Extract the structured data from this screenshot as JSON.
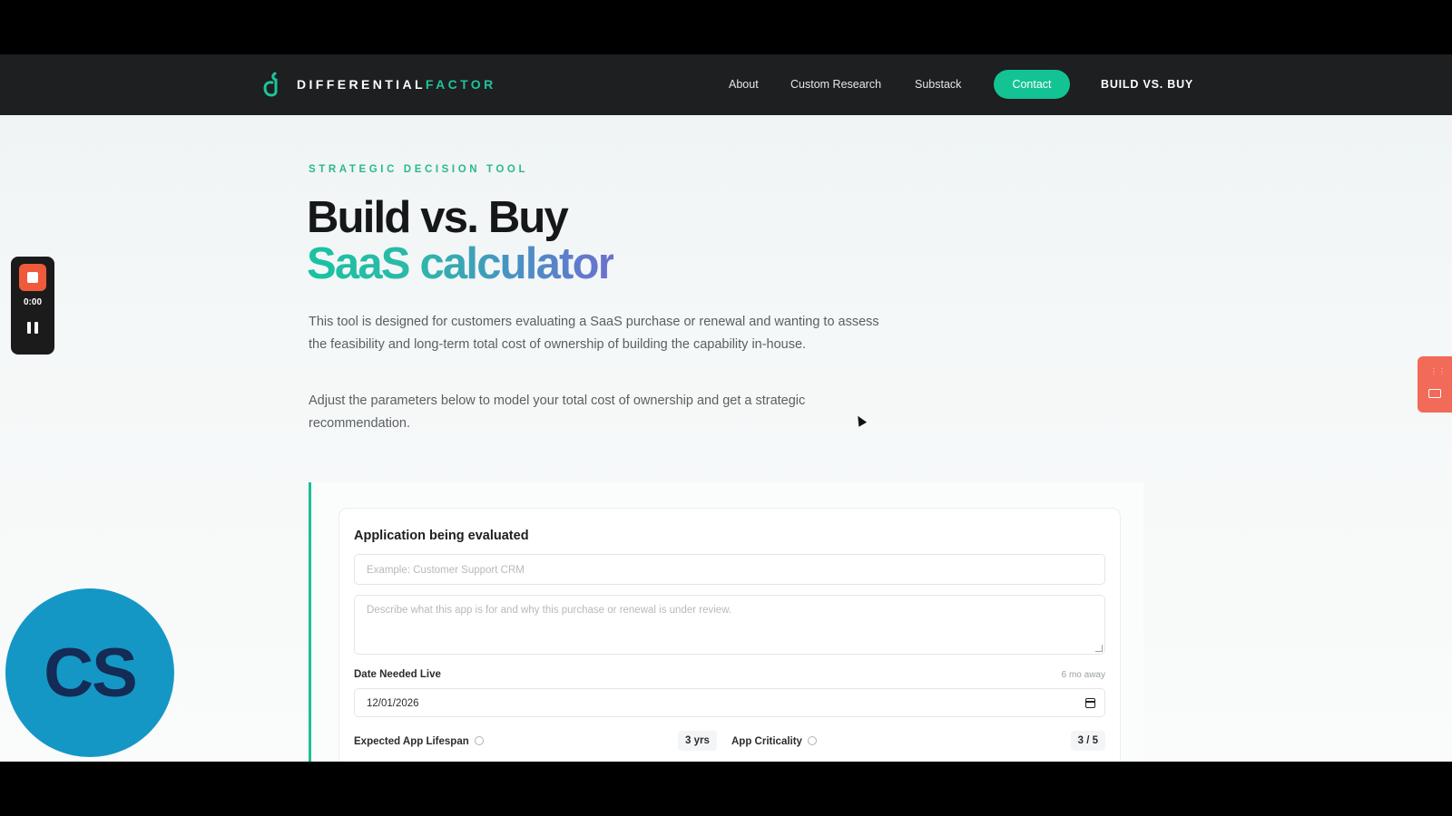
{
  "header": {
    "logo": {
      "word1": "DIFFERENTIAL",
      "word2": "FACTOR",
      "icon": "df-logo-icon",
      "accent": "#1fc39a"
    },
    "nav": {
      "about": "About",
      "custom_research": "Custom Research",
      "substack": "Substack"
    },
    "contact_label": "Contact",
    "build_vs_buy": "BUILD VS. BUY"
  },
  "hero": {
    "eyebrow": "STRATEGIC DECISION TOOL",
    "title_line1": "Build vs. Buy",
    "title_line2": "SaaS calculator",
    "description1": "This tool is designed for customers evaluating a SaaS purchase or renewal and wanting to assess the feasibility and long-term total cost of ownership of building the capability in-house.",
    "description2": "Adjust the parameters below to model your total cost of ownership and get a strategic recommendation."
  },
  "form": {
    "section_title": "Application being evaluated",
    "name_placeholder": "Example: Customer Support CRM",
    "description_placeholder": "Describe what this app is for and why this purchase or renewal is under review.",
    "date_label": "Date Needed Live",
    "date_hint": "6 mo away",
    "date_value": "12/01/2026",
    "lifespan_label": "Expected App Lifespan",
    "lifespan_value": "3 yrs",
    "criticality_label": "App Criticality",
    "criticality_value": "3 / 5"
  },
  "recorder": {
    "time": "0:00"
  },
  "avatar": {
    "initials": "CS",
    "color": "#1597c6"
  },
  "colors": {
    "accent": "#14c393",
    "navbar": "#1d1f20",
    "side_tab": "#f26a58"
  }
}
